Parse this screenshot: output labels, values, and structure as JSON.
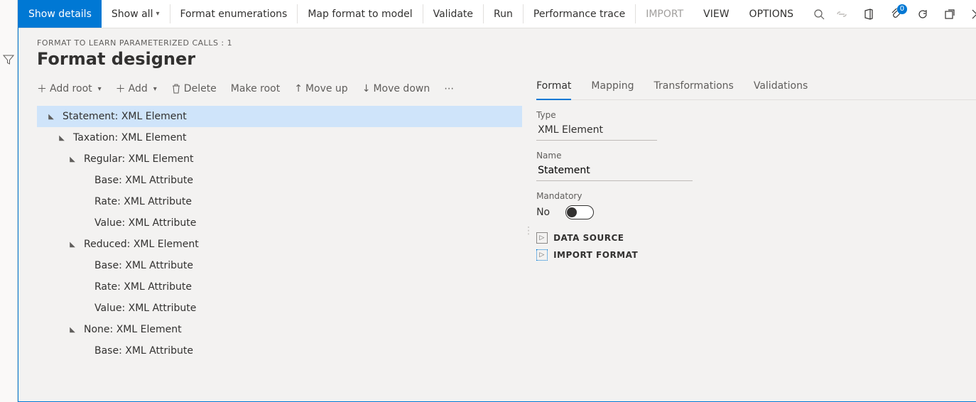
{
  "toolbar": {
    "show_details": "Show details",
    "show_all": "Show all",
    "format_enum": "Format enumerations",
    "map_format": "Map format to model",
    "validate": "Validate",
    "run": "Run",
    "perf_trace": "Performance trace",
    "import": "IMPORT",
    "view": "VIEW",
    "options": "OPTIONS"
  },
  "breadcrumb": "FORMAT TO LEARN PARAMETERIZED CALLS : 1",
  "page_title": "Format designer",
  "actions": {
    "add_root": "Add root",
    "add": "Add",
    "delete": "Delete",
    "make_root": "Make root",
    "move_up": "Move up",
    "move_down": "Move down"
  },
  "tree": [
    {
      "level": 0,
      "label": "Statement: XML Element",
      "expandable": true,
      "selected": true
    },
    {
      "level": 1,
      "label": "Taxation: XML Element",
      "expandable": true
    },
    {
      "level": 2,
      "label": "Regular: XML Element",
      "expandable": true
    },
    {
      "level": 3,
      "label": "Base: XML Attribute",
      "expandable": false
    },
    {
      "level": 3,
      "label": "Rate: XML Attribute",
      "expandable": false
    },
    {
      "level": 3,
      "label": "Value: XML Attribute",
      "expandable": false
    },
    {
      "level": 2,
      "label": "Reduced: XML Element",
      "expandable": true
    },
    {
      "level": 3,
      "label": "Base: XML Attribute",
      "expandable": false
    },
    {
      "level": 3,
      "label": "Rate: XML Attribute",
      "expandable": false
    },
    {
      "level": 3,
      "label": "Value: XML Attribute",
      "expandable": false
    },
    {
      "level": 2,
      "label": "None: XML Element",
      "expandable": true
    },
    {
      "level": 3,
      "label": "Base: XML Attribute",
      "expandable": false
    }
  ],
  "side_tabs": [
    "Format",
    "Mapping",
    "Transformations",
    "Validations"
  ],
  "side_active_tab": 0,
  "details": {
    "type_label": "Type",
    "type_value": "XML Element",
    "name_label": "Name",
    "name_value": "Statement",
    "mandatory_label": "Mandatory",
    "mandatory_value": "No"
  },
  "sections": {
    "data_source": "DATA SOURCE",
    "import_format": "IMPORT FORMAT"
  },
  "badge_count": "0"
}
